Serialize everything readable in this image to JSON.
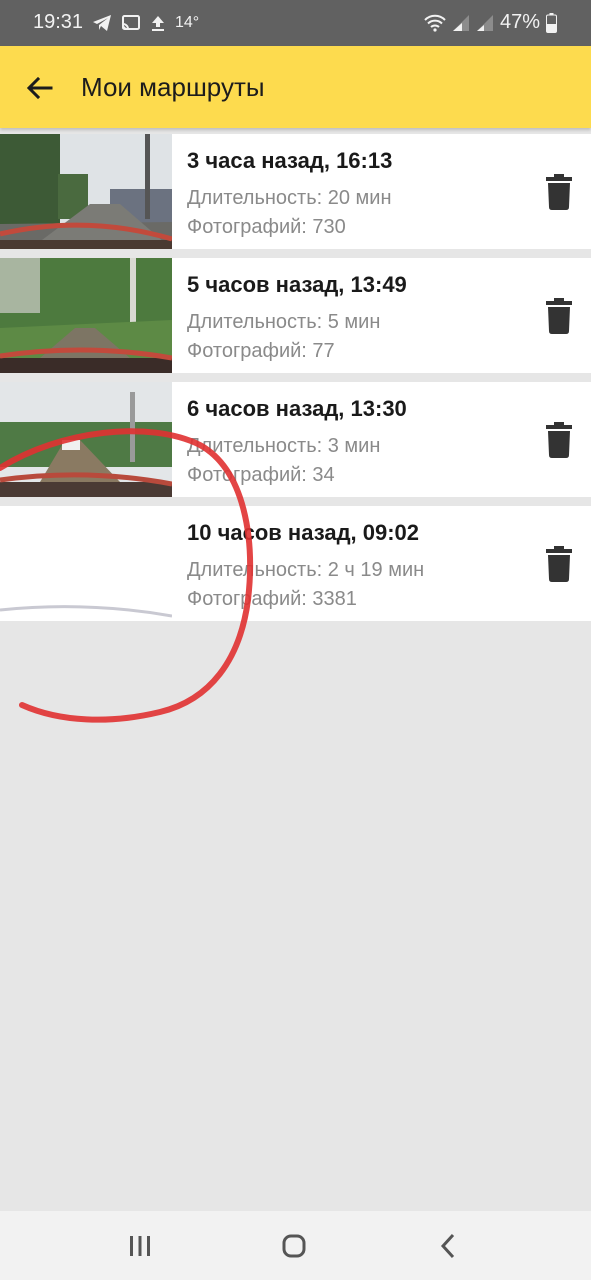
{
  "status_bar": {
    "time": "19:31",
    "temperature": "14°",
    "battery": "47%",
    "icons": [
      "telegram-icon",
      "cast-icon",
      "upload-icon",
      "wifi-icon",
      "signal-icon",
      "battery-icon"
    ]
  },
  "app_bar": {
    "title": "Мои маршруты",
    "background": "#fddb4e",
    "back_icon": "arrow-left-icon"
  },
  "routes": [
    {
      "title": "3 часа назад, 16:13",
      "duration": "Длительность: 20 мин",
      "photos": "Фотографий: 730"
    },
    {
      "title": "5 часов назад, 13:49",
      "duration": "Длительность: 5 мин",
      "photos": "Фотографий: 77"
    },
    {
      "title": "6 часов назад, 13:30",
      "duration": "Длительность: 3 мин",
      "photos": "Фотографий: 34"
    },
    {
      "title": "10 часов назад, 09:02",
      "duration": "Длительность: 2 ч 19 мин",
      "photos": "Фотографий: 3381"
    }
  ],
  "row_action_icon": "trash-icon",
  "annotation_color": "#e03131",
  "nav_bar": {
    "buttons": [
      "recent-apps-icon",
      "home-icon",
      "back-icon"
    ]
  }
}
